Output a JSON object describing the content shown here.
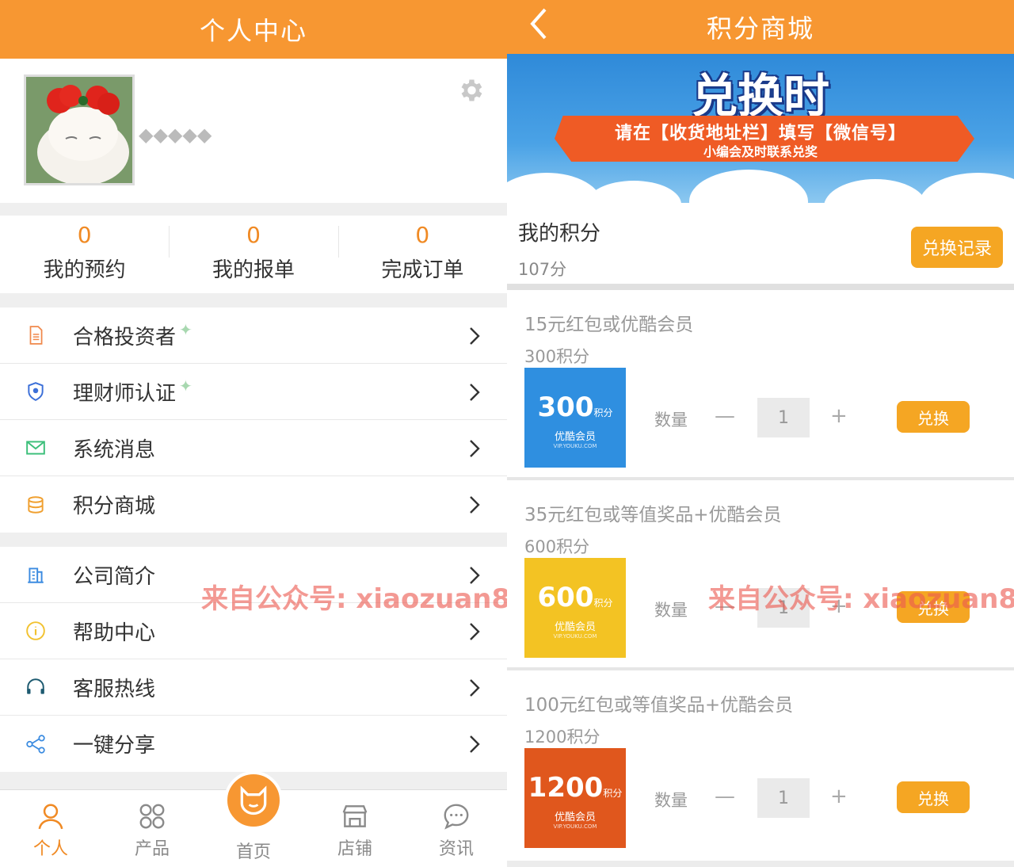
{
  "left": {
    "header": {
      "title": "个人中心"
    },
    "profile": {
      "username": "◆◆◆◆◆"
    },
    "stats": [
      {
        "value": "0",
        "label": "我的预约"
      },
      {
        "value": "0",
        "label": "我的报单"
      },
      {
        "value": "0",
        "label": "完成订单"
      }
    ],
    "menu_group1": [
      {
        "label": "合格投资者",
        "icon": "document-icon"
      },
      {
        "label": "理财师认证",
        "icon": "shield-icon"
      },
      {
        "label": "系统消息",
        "icon": "envelope-icon"
      },
      {
        "label": "积分商城",
        "icon": "coins-icon"
      }
    ],
    "menu_group2": [
      {
        "label": "公司简介",
        "icon": "building-icon"
      },
      {
        "label": "帮助中心",
        "icon": "info-icon"
      },
      {
        "label": "客服热线",
        "icon": "headset-icon"
      },
      {
        "label": "一键分享",
        "icon": "share-icon"
      }
    ],
    "tabs": [
      {
        "label": "个人",
        "icon": "person-icon",
        "active": true
      },
      {
        "label": "产品",
        "icon": "grid-icon"
      },
      {
        "label": "首页",
        "icon": "cat-icon"
      },
      {
        "label": "店铺",
        "icon": "store-icon"
      },
      {
        "label": "资讯",
        "icon": "chat-icon"
      }
    ],
    "watermark": "来自公众号: xiaozuan8"
  },
  "right": {
    "header": {
      "title": "积分商城"
    },
    "banner": {
      "title": "兑换时",
      "line1": "请在【收货地址栏】填写【微信号】",
      "line2": "小编会及时联系兑奖"
    },
    "points": {
      "title": "我的积分",
      "value": "107分",
      "record_button": "兑换记录"
    },
    "quantity_label": "数量",
    "minus": "—",
    "plus": "+",
    "items": [
      {
        "name": "15元红包或优酷会员",
        "cost": "300积分",
        "img_big": "300",
        "img_unit": "积分",
        "img_sub": "优酷会员",
        "img_tiny": "VIP.YOUKU.COM",
        "qty": "1",
        "button": "兑换",
        "color": "#2f8fe0"
      },
      {
        "name": "35元红包或等值奖品+优酷会员",
        "cost": "600积分",
        "img_big": "600",
        "img_unit": "积分",
        "img_sub": "优酷会员",
        "img_tiny": "VIP.YOUKU.COM",
        "qty": "1",
        "button": "兑换",
        "color": "#f3c323"
      },
      {
        "name": "100元红包或等值奖品+优酷会员",
        "cost": "1200积分",
        "img_big": "1200",
        "img_unit": "积分",
        "img_sub": "优酷会员",
        "img_tiny": "VIP.YOUKU.COM",
        "qty": "1",
        "button": "兑换",
        "color": "#e0571d"
      }
    ],
    "watermark": "来自公众号: xiaozuan8"
  },
  "colors": {
    "accent": "#f79732",
    "button": "#f5a623"
  }
}
